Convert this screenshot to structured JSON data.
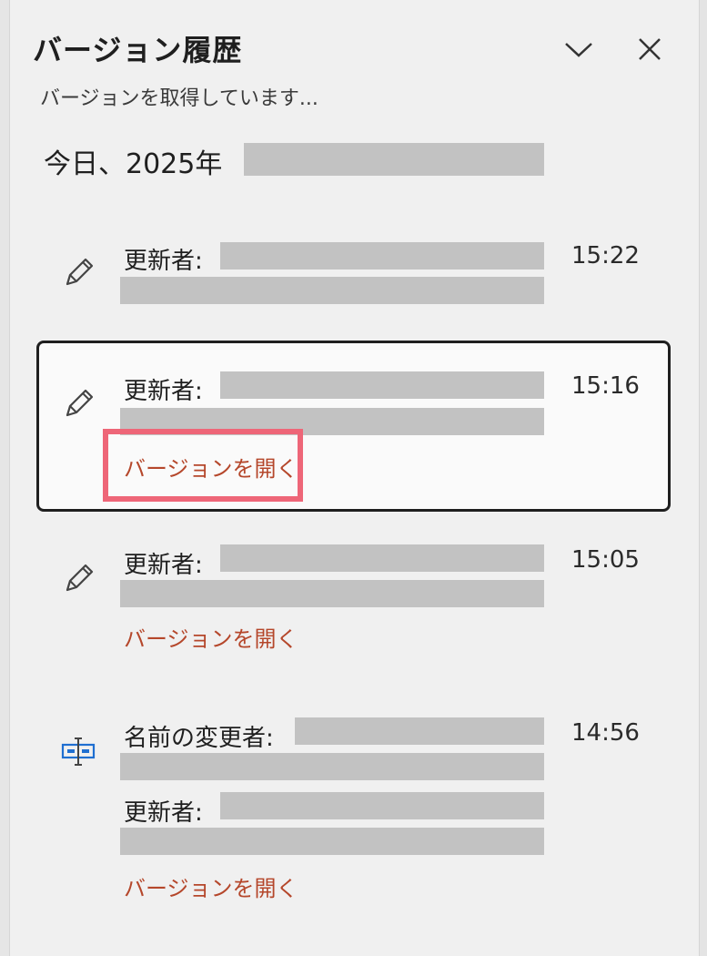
{
  "panel": {
    "title": "バージョン履歴",
    "status": "バージョンを取得しています...",
    "collapse_icon": "chevron-down-icon",
    "close_icon": "close-icon"
  },
  "date_group": {
    "label": "今日、2025年"
  },
  "versions": [
    {
      "icon": "pencil-icon",
      "updated_label": "更新者:",
      "time": "15:22",
      "selected": false
    },
    {
      "icon": "pencil-icon",
      "updated_label": "更新者:",
      "time": "15:16",
      "open_label": "バージョンを開く",
      "selected": true
    },
    {
      "icon": "pencil-icon",
      "updated_label": "更新者:",
      "time": "15:05",
      "open_label": "バージョンを開く",
      "selected": false
    },
    {
      "icon": "rename-icon",
      "renamed_label": "名前の変更者:",
      "updated_label": "更新者:",
      "time": "14:56",
      "open_label": "バージョンを開く",
      "selected": false
    }
  ],
  "colors": {
    "link": "#b5472b",
    "highlight": "#ee6678",
    "redaction": "#c2c2c2",
    "rename_icon": "#1f6fd1"
  }
}
